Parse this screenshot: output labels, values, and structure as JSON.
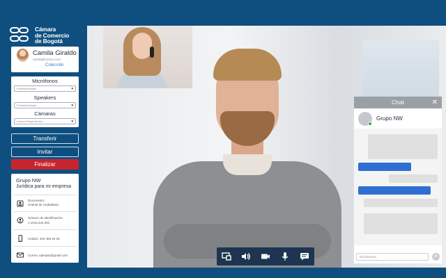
{
  "brand": {
    "lines": [
      "Cámara",
      "de Comercio",
      "de Bogotá"
    ]
  },
  "profile": {
    "name": "Camila Giraldo",
    "email": "camila@correo.com",
    "role": "Colección"
  },
  "devices": {
    "microphones_label": "Micrófonos",
    "microphone_value": "Predeterminado",
    "speakers_label": "Speakers",
    "speaker_value": "Predeterminado",
    "cameras_label": "Cámaras",
    "camera_value": "Lenovo EasyCamera"
  },
  "actions": {
    "transfer": "Transferir",
    "invite": "Invitar",
    "end": "Finalizar"
  },
  "client": {
    "org": "Grupo NW",
    "desc": "Jurídica para mi empresa",
    "document_label": "Documento:",
    "document_value": "Cédula de ciudadanía",
    "id_label": "Número de identificación:",
    "id_value": "1.1016.344.281",
    "phone": "Celular: 319 455 25 36",
    "email": "Correo: ejemplo@gmail.com"
  },
  "chat": {
    "title": "Chat",
    "close": "✕",
    "group": "Grupo NW",
    "input_placeholder": "Escribiendo...",
    "send": "➤"
  },
  "controls": [
    "share-screen",
    "volume",
    "camera",
    "microphone",
    "messages"
  ],
  "colors": {
    "bg": "#0f4f80",
    "danger": "#c8242f",
    "accent": "#2f6fd1",
    "online": "#2fa84f"
  }
}
